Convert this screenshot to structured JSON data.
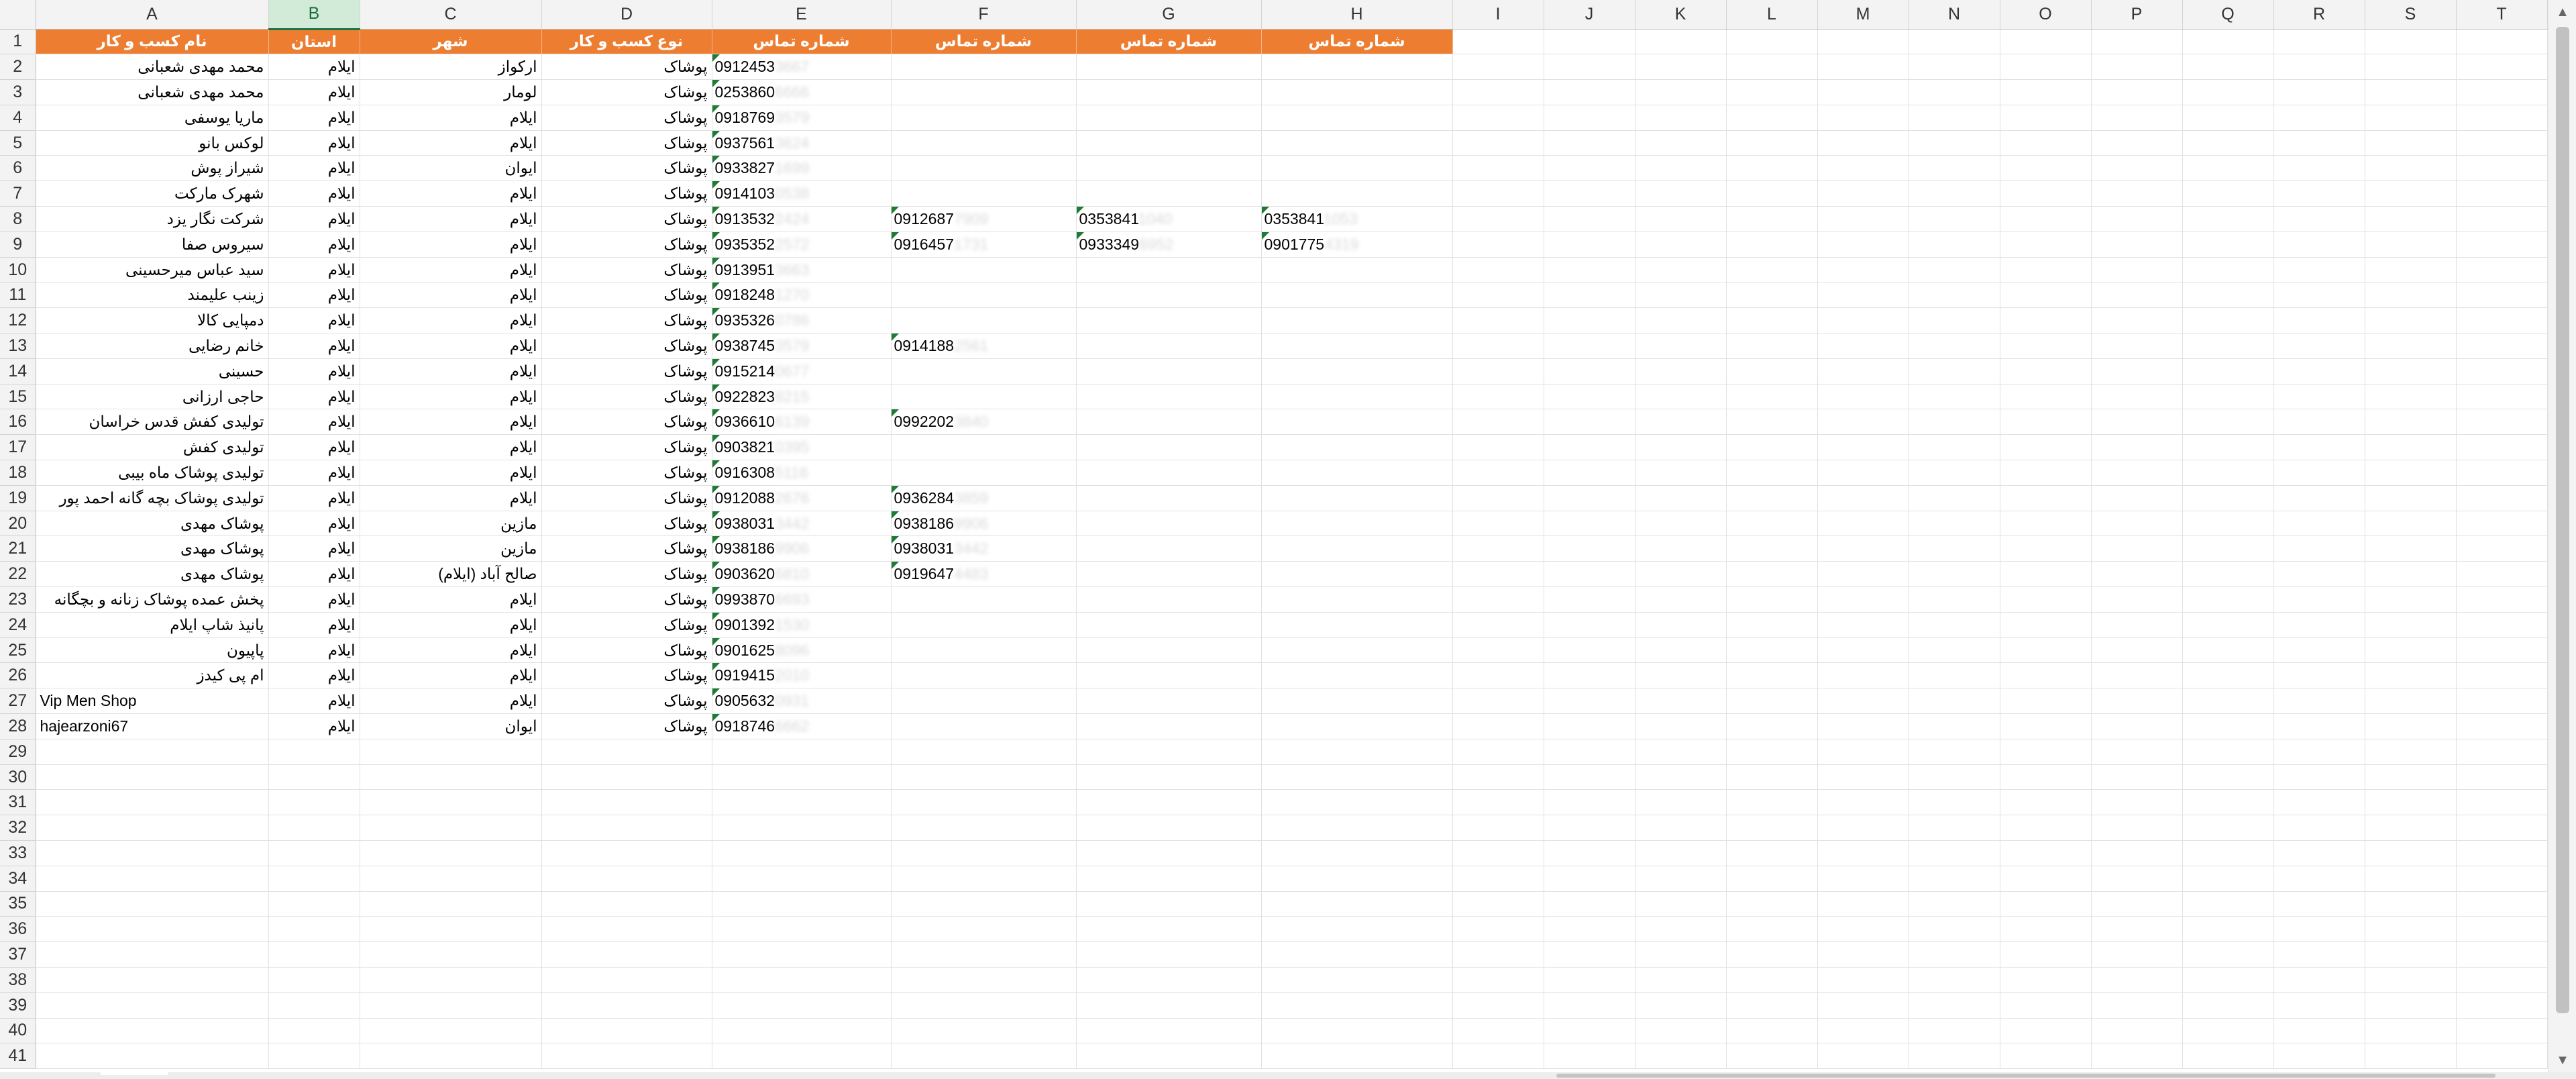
{
  "columns": [
    "A",
    "B",
    "C",
    "D",
    "E",
    "F",
    "G",
    "H",
    "I",
    "J",
    "K",
    "L",
    "M",
    "N",
    "O",
    "P",
    "Q",
    "R",
    "S",
    "T"
  ],
  "selected_column": "B",
  "header_row": {
    "a": "نام کسب و کار",
    "b": "استان",
    "c": "شهر",
    "d": "نوع کسب و کار",
    "e": "شماره تماس",
    "f": "شماره تماس",
    "g": "شماره تماس",
    "h": "شماره تماس"
  },
  "rows": [
    {
      "a": "محمد مهدی شعبانی",
      "b": "ایلام",
      "c": "اركواز",
      "d": "پوشاک",
      "e": "0912453",
      "e_tail": "3667"
    },
    {
      "a": "محمد مهدی شعبانی",
      "b": "ایلام",
      "c": "لومار",
      "d": "پوشاک",
      "e": "0253860",
      "e_tail": "6666"
    },
    {
      "a": "ماریا یوسفی",
      "b": "ایلام",
      "c": "ایلام",
      "d": "پوشاک",
      "e": "0918769",
      "e_tail": "3579"
    },
    {
      "a": "لوکس بانو",
      "b": "ایلام",
      "c": "ایلام",
      "d": "پوشاک",
      "e": "0937561",
      "e_tail": "3624"
    },
    {
      "a": "شیراز پوش",
      "b": "ایلام",
      "c": "ایوان",
      "d": "پوشاک",
      "e": "0933827",
      "e_tail": "1699"
    },
    {
      "a": "شهرک مارکت",
      "b": "ایلام",
      "c": "ایلام",
      "d": "پوشاک",
      "e": "0914103",
      "e_tail": "0538"
    },
    {
      "a": "شرکت نگار یزد",
      "b": "ایلام",
      "c": "ایلام",
      "d": "پوشاک",
      "e": "0913532",
      "e_tail": "2424",
      "f": "0912687",
      "f_tail": "7909",
      "g": "0353841",
      "g_tail": "1040",
      "h": "0353841",
      "h_tail": "1053"
    },
    {
      "a": "سیروس صفا",
      "b": "ایلام",
      "c": "ایلام",
      "d": "پوشاک",
      "e": "0935352",
      "e_tail": "2572",
      "f": "0916457",
      "f_tail": "1731",
      "g": "0933349",
      "g_tail": "6952",
      "h": "0901775",
      "h_tail": "4319"
    },
    {
      "a": "سید عباس میرحسینی",
      "b": "ایلام",
      "c": "ایلام",
      "d": "پوشاک",
      "e": "0913951",
      "e_tail": "3663"
    },
    {
      "a": "زینب علیمند",
      "b": "ایلام",
      "c": "ایلام",
      "d": "پوشاک",
      "e": "0918248",
      "e_tail": "1270"
    },
    {
      "a": "دمپایی کالا",
      "b": "ایلام",
      "c": "ایلام",
      "d": "پوشاک",
      "e": "0935326",
      "e_tail": "0786"
    },
    {
      "a": "خانم رضایی",
      "b": "ایلام",
      "c": "ایلام",
      "d": "پوشاک",
      "e": "0938745",
      "e_tail": "3579",
      "f": "0914188",
      "f_tail": "2561"
    },
    {
      "a": "حسینی",
      "b": "ایلام",
      "c": "ایلام",
      "d": "پوشاک",
      "e": "0915214",
      "e_tail": "0677"
    },
    {
      "a": "حاجی ارزانی",
      "b": "ایلام",
      "c": "ایلام",
      "d": "پوشاک",
      "e": "0922823",
      "e_tail": "8215"
    },
    {
      "a": "تولیدی کفش قدس خراسان",
      "b": "ایلام",
      "c": "ایلام",
      "d": "پوشاک",
      "e": "0936610",
      "e_tail": "6139",
      "f": "0992202",
      "f_tail": "3840"
    },
    {
      "a": "تولیدی کفش",
      "b": "ایلام",
      "c": "ایلام",
      "d": "پوشاک",
      "e": "0903821",
      "e_tail": "0395"
    },
    {
      "a": "تولیدی پوشاک ماه بیبی",
      "b": "ایلام",
      "c": "ایلام",
      "d": "پوشاک",
      "e": "0916308",
      "e_tail": "5116"
    },
    {
      "a": "تولیدی پوشاک بچه گانه  احمد پور",
      "b": "ایلام",
      "c": "ایلام",
      "d": "پوشاک",
      "e": "0912088",
      "e_tail": "2676",
      "f": "0936284",
      "f_tail": "3859"
    },
    {
      "a": "پوشاک مهدی",
      "b": "ایلام",
      "c": "مازین",
      "d": "پوشاک",
      "e": "0938031",
      "e_tail": "3442",
      "f": "0938186",
      "f_tail": "9906"
    },
    {
      "a": "پوشاک مهدی",
      "b": "ایلام",
      "c": "مازین",
      "d": "پوشاک",
      "e": "0938186",
      "e_tail": "9906",
      "f": "0938031",
      "f_tail": "3442"
    },
    {
      "a": "پوشاک مهدی",
      "b": "ایلام",
      "c": "صالح آباد (ایلام)",
      "d": "پوشاک",
      "e": "0903620",
      "e_tail": "6810",
      "f": "0919647",
      "f_tail": "4483"
    },
    {
      "a": "پخش عمده پوشاک زنانه و بچگانه",
      "b": "ایلام",
      "c": "ایلام",
      "d": "پوشاک",
      "e": "0993870",
      "e_tail": "6693"
    },
    {
      "a": "پانیذ شاپ ایلام",
      "b": "ایلام",
      "c": "ایلام",
      "d": "پوشاک",
      "e": "0901392",
      "e_tail": "1530"
    },
    {
      "a": "پاپیون",
      "b": "ایلام",
      "c": "ایلام",
      "d": "پوشاک",
      "e": "0901625",
      "e_tail": "8096"
    },
    {
      "a": "ام پی کیدز",
      "b": "ایلام",
      "c": "ایلام",
      "d": "پوشاک",
      "e": "0919415",
      "e_tail": "2010"
    },
    {
      "a": "Vip Men Shop",
      "b": "ایلام",
      "c": "ایلام",
      "d": "پوشاک",
      "e": "0905632",
      "e_tail": "0931"
    },
    {
      "a": "hajearzoni67",
      "b": "ایلام",
      "c": "ایوان",
      "d": "پوشاک",
      "e": "0918746",
      "e_tail": "6662"
    }
  ],
  "row_numbers": [
    "1",
    "2",
    "3",
    "4",
    "5",
    "6",
    "7",
    "8",
    "9",
    "10",
    "11",
    "12",
    "13",
    "14",
    "15",
    "16",
    "17",
    "18",
    "19",
    "20",
    "21",
    "22",
    "23",
    "24",
    "25",
    "26",
    "27",
    "28",
    "29",
    "30",
    "31",
    "32",
    "33",
    "34",
    "35",
    "36",
    "37",
    "38",
    "39",
    "40",
    "41"
  ],
  "colors": {
    "header_fill": "#ed7d31",
    "header_text": "#ffffff",
    "selection": "#217346",
    "comment_marker": "#1e7b34"
  }
}
